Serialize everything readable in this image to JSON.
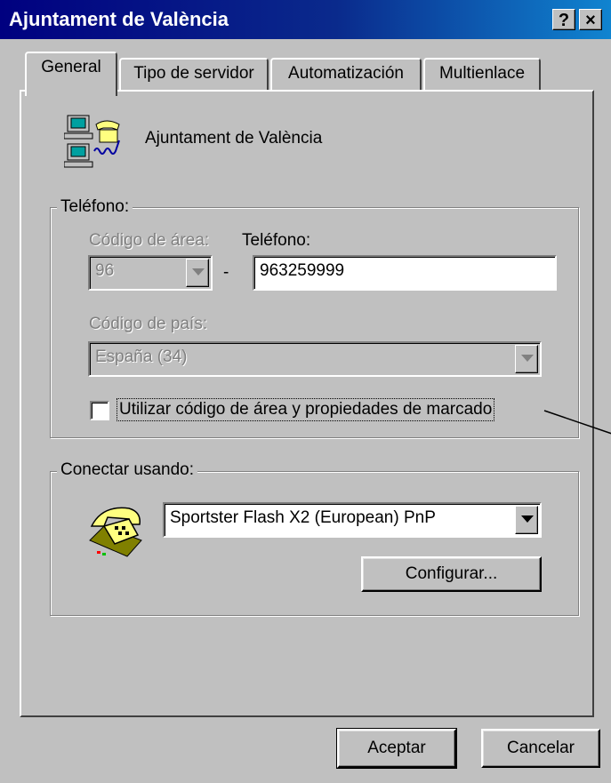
{
  "window": {
    "title": "Ajuntament de València",
    "help_button": "?",
    "close_button": "×"
  },
  "tabs": [
    {
      "label": "General",
      "active": true
    },
    {
      "label": "Tipo de servidor",
      "active": false
    },
    {
      "label": "Automatización",
      "active": false
    },
    {
      "label": "Multienlace",
      "active": false
    }
  ],
  "connection": {
    "name": "Ajuntament de València",
    "icon": "dialup-computers-icon"
  },
  "phone_group": {
    "legend": "Teléfono:",
    "area_code_label": "Código de área:",
    "area_code_value": "96",
    "phone_label": "Teléfono:",
    "phone_value": "963259999",
    "separator": "-",
    "country_label": "Código de país:",
    "country_value": "España (34)",
    "use_area_code_label": "Utilizar código de área y propiedades de marcado",
    "use_area_code_checked": false
  },
  "connect_group": {
    "legend": "Conectar usando:",
    "modem_icon": "telephone-modem-icon",
    "modem_value": "Sportster Flash X2 (European) PnP",
    "configure_label": "Configurar..."
  },
  "footer": {
    "ok_label": "Aceptar",
    "cancel_label": "Cancelar"
  },
  "colors": {
    "titlebar": "#000080",
    "face": "#c0c0c0",
    "disabled_text": "#808080"
  }
}
